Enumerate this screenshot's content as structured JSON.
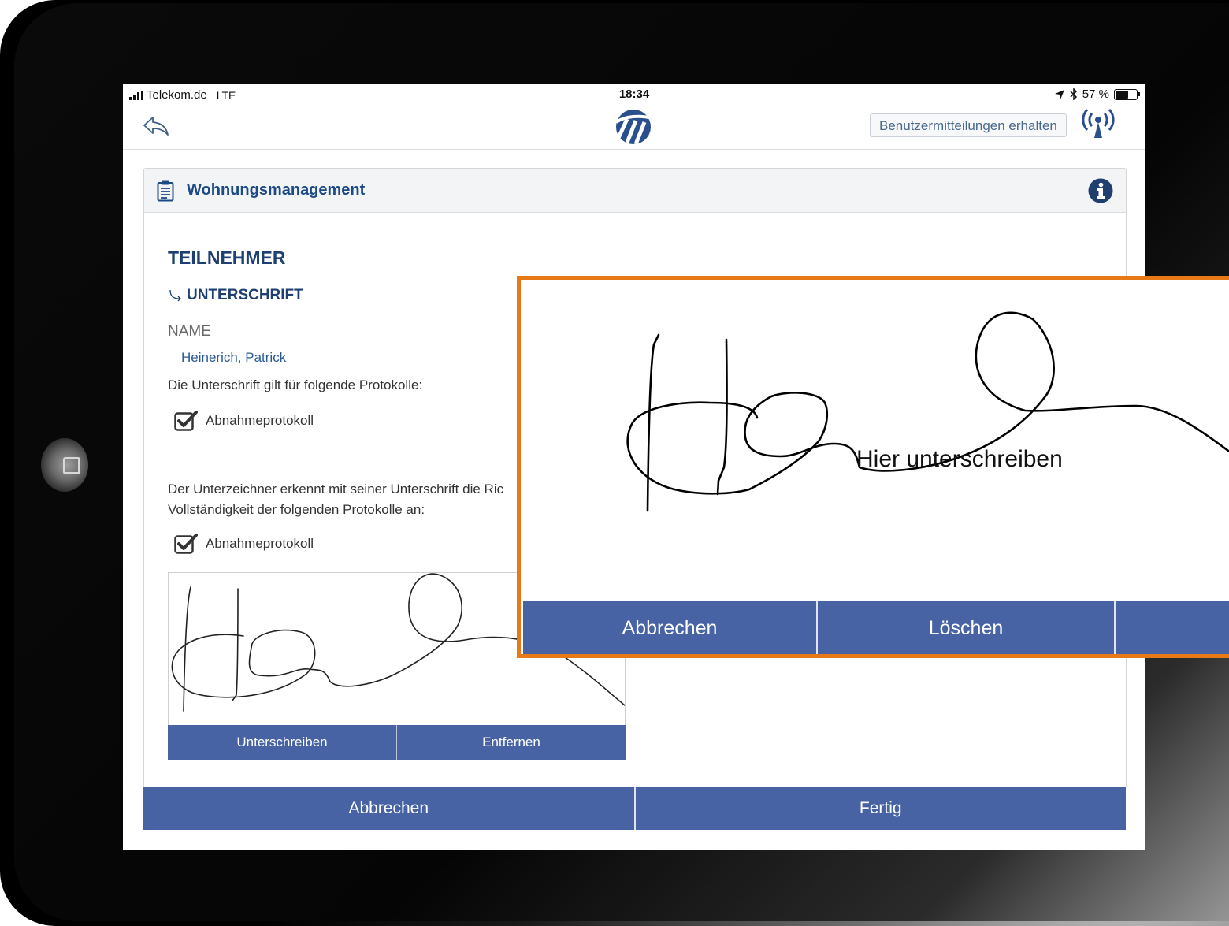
{
  "status_bar": {
    "carrier": "Telekom.de",
    "network": "LTE",
    "time": "18:34",
    "battery": "57 %",
    "battery_level": 0.57
  },
  "navbar": {
    "notify_button": "Benutzermitteilungen erhalten"
  },
  "panel": {
    "title": "Wohnungsmanagement",
    "section_title": "TEILNEHMER",
    "sub_title": "UNTERSCHRIFT",
    "name_label": "NAME",
    "name_value": "Heinerich, Patrick",
    "valid_text": "Die Unterschrift gilt für folgende Protokolle:",
    "check_1_label": "Abnahmeprotokoll",
    "ack_text_line1": "Der Unterzeichner erkennt mit seiner Unterschrift die Ric",
    "ack_text_line2": "Vollständigkeit der folgenden Protokolle an:",
    "check_2_label": "Abnahmeprotokoll",
    "sign_button": "Unterschreiben",
    "remove_button": "Entfernen",
    "cancel_button": "Abbrechen",
    "done_button": "Fertig"
  },
  "zoom_overlay": {
    "hint": "Hier unterschreiben",
    "cancel_button": "Abbrechen",
    "clear_button": "Löschen"
  },
  "colors": {
    "button_blue": "#4863a4",
    "title_blue": "#1c4a86",
    "highlight_orange": "#e77917"
  }
}
